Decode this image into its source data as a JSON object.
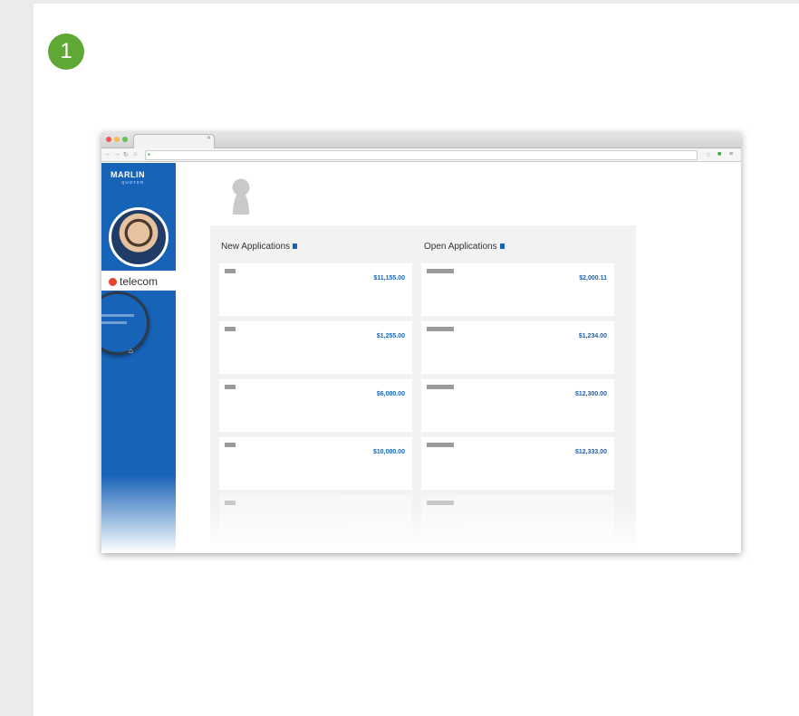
{
  "step": {
    "number": "1"
  },
  "browser": {
    "tab_title": "",
    "url": "",
    "colors": {
      "close": "#ee5a52",
      "minimize": "#f4bd4f",
      "maximize": "#5fc454"
    }
  },
  "app": {
    "logo": "MARLIN",
    "logo_sub": "QUOTER",
    "brand": "telecom",
    "magnifier_title": "",
    "sidebar_footer": "",
    "accent": "#1763b7"
  },
  "contact": {
    "line1": "",
    "line2": "",
    "email": "",
    "link": ""
  },
  "columns": {
    "new_title": "New Applications",
    "open_title": "Open Applications"
  },
  "new_apps": [
    {
      "name": "",
      "email": "",
      "company": "",
      "amount": "$11,155.00"
    },
    {
      "name": "",
      "email": "",
      "company": "",
      "amount": "$1,255.00"
    },
    {
      "name": "",
      "email": "",
      "company": "",
      "amount": "$6,000.00"
    },
    {
      "name": "",
      "email": "",
      "company": "",
      "amount": "$10,000.00"
    },
    {
      "name": "",
      "email": "",
      "company": "",
      "amount": ""
    }
  ],
  "open_apps": [
    {
      "name": "",
      "email": "",
      "company": "",
      "amount": "$2,000.11"
    },
    {
      "name": "",
      "email": "",
      "company": "",
      "amount": "$1,234.00"
    },
    {
      "name": "",
      "email": "",
      "company": "",
      "amount": "$12,300.00"
    },
    {
      "name": "",
      "email": "",
      "company": "",
      "amount": "$12,333.00"
    },
    {
      "name": "",
      "email": "",
      "company": "",
      "amount": ""
    }
  ]
}
